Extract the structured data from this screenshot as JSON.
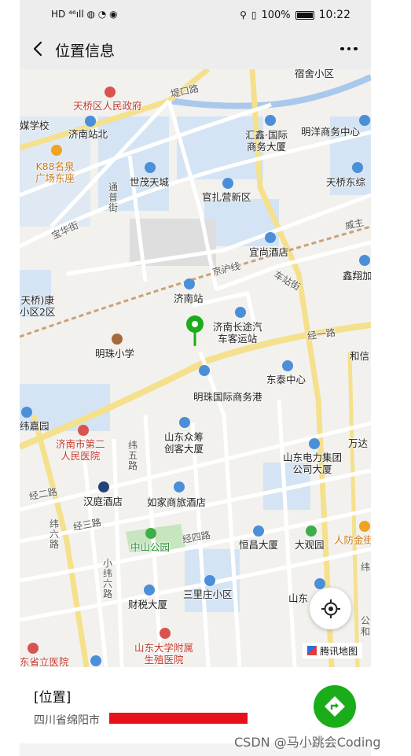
{
  "status_bar": {
    "left_indicators": "HD ⁴⁶ıll ◍ ◔ ◉",
    "battery": "100%",
    "time": "10:22"
  },
  "nav": {
    "title": "位置信息"
  },
  "map": {
    "provider": "腾讯地图",
    "labels": {
      "xisu": "宿舍小区",
      "tiqiao_gov": "天桥区人民政府",
      "dikou": "堤口路",
      "meiti": "媒学校",
      "jinan_north": "济南站北",
      "huixin": "汇鑫·国际\n商务大厦",
      "mingyang": "明洋商务中心",
      "k88": "K88名泉\n广场东座",
      "shimao": "世茂天城",
      "tongpu": "通\n普\n街",
      "guanzhaying": "官扎营新区",
      "tianqiao_east": "天桥东综",
      "baohua": "宝华街",
      "weizhu": "威主",
      "yishang": "宜尚酒店",
      "xinxiang": "鑫翔加",
      "jinghu": "京沪线",
      "chezhan": "车站街",
      "jinan_station": "济南站",
      "tianqiao_kang": "天桥)康\n小区2区",
      "changtu": "济南长途汽\n车客运站",
      "mingzhu_school": "明珠小学",
      "jingyi": "经一路",
      "hexin": "和信",
      "dongtai": "东泰中心",
      "mingzhu_intl": "明珠国际商务港",
      "weijia": "纬嘉园",
      "hospital2": "济南市第二\n人民医院",
      "weiwu": "纬\n五\n路",
      "sdzc": "山东众筹\n创客大厦",
      "wanda": "万达",
      "sdpower": "山东电力集团\n公司大厦",
      "jinger": "经二路",
      "hanting": "汉庭酒店",
      "rujia": "如家商旅酒店",
      "weiliu": "纬\n六\n路",
      "jingsan": "经三路",
      "zhongshan": "中山公园",
      "jingsi": "经四路",
      "hengchang": "恒昌大厦",
      "daguan": "大观园",
      "renfang": "人防金街",
      "wei_r": "纬",
      "xiaoweiliu": "小\n纬\n六\n路",
      "caishui": "财税大厦",
      "sanli": "三里庄小区",
      "shandong_r": "山东",
      "gong_r": "公\n和",
      "sdu": "山东大学附属\n生殖医院",
      "zhongyi": "东省立医院"
    }
  },
  "panel": {
    "place_name": "[位置]",
    "address": "四川省绵阳市"
  },
  "watermark": "CSDN @马小跳会Coding",
  "colors": {
    "navigate_button": "#1aad19",
    "pin": "#1aad19",
    "redaction": "#e8101a"
  }
}
